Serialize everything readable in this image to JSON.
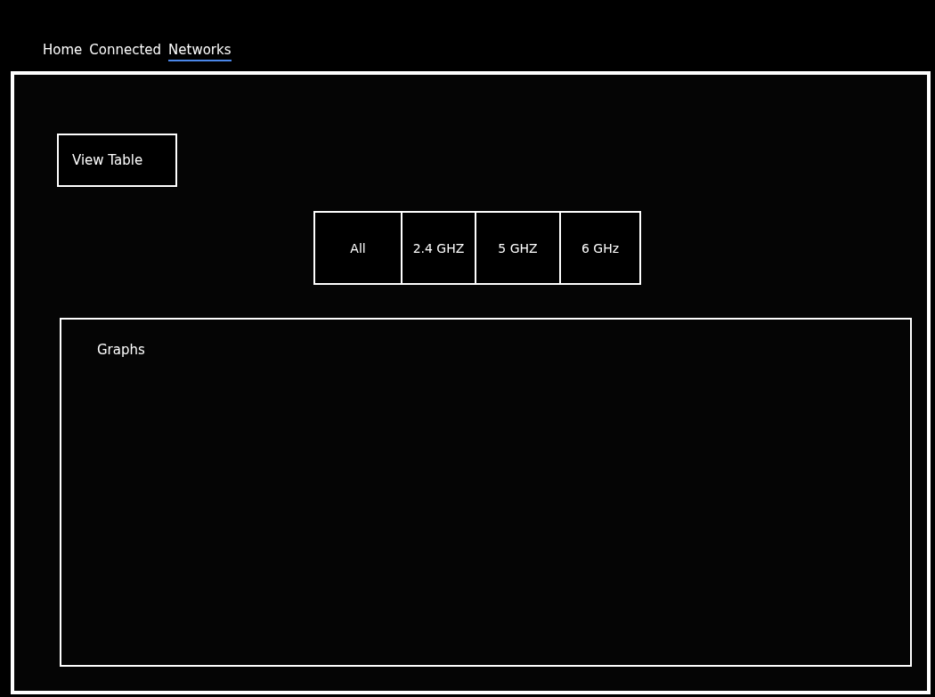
{
  "tabs": [
    {
      "label": "Home",
      "selected": false
    },
    {
      "label": "Connected",
      "selected": false
    },
    {
      "label": "Networks",
      "selected": true
    }
  ],
  "view_button": {
    "label": "View Table"
  },
  "band_filters": [
    {
      "label": "All"
    },
    {
      "label": "2.4 GHZ"
    },
    {
      "label": "5 GHZ"
    },
    {
      "label": "6 GHz"
    }
  ],
  "graphs_panel": {
    "title": "Graphs"
  }
}
